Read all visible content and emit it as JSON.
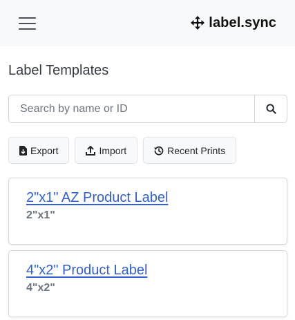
{
  "header": {
    "brand_name": "label.sync"
  },
  "page": {
    "title": "Label Templates"
  },
  "search": {
    "placeholder": "Search by name or ID",
    "value": ""
  },
  "actions": {
    "export_label": "Export",
    "import_label": "Import",
    "recent_label": "Recent Prints"
  },
  "templates": [
    {
      "name": "2\"x1\" AZ Product Label",
      "size": "2\"x1\""
    },
    {
      "name": "4\"x2\" Product Label",
      "size": "4\"x2\""
    }
  ],
  "colors": {
    "link": "#2f5fd0",
    "topbar_bg": "#f8f9fa"
  }
}
